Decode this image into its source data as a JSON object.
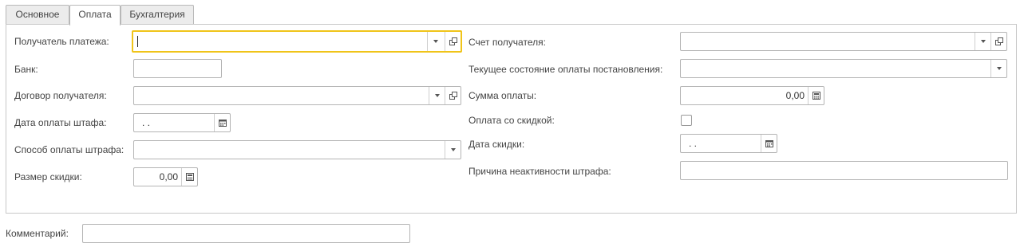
{
  "tabs": [
    {
      "label": "Основное"
    },
    {
      "label": "Оплата"
    },
    {
      "label": "Бухгалтерия"
    }
  ],
  "left": {
    "recipient_label": "Получатель платежа:",
    "bank_label": "Банк:",
    "contract_label": "Договор получателя:",
    "fine_payment_date_label": "Дата оплаты штафа:",
    "fine_payment_date_value": " .  .",
    "fine_payment_method_label": "Способ оплаты штрафа:",
    "discount_size_label": "Размер скидки:",
    "discount_size_value": "0,00"
  },
  "right": {
    "recipient_account_label": "Счет получателя:",
    "current_payment_state_label": "Текущее состояние оплаты постановления:",
    "payment_amount_label": "Сумма оплаты:",
    "payment_amount_value": "0,00",
    "paid_with_discount_label": "Оплата со скидкой:",
    "paid_with_discount_checked": false,
    "discount_date_label": "Дата скидки:",
    "discount_date_value": " .  .",
    "fine_inactivity_reason_label": "Причина неактивности штрафа:"
  },
  "footer": {
    "comment_label": "Комментарий:"
  },
  "icons": {
    "dropdown": "chevron-down-icon",
    "open": "open-form-icon",
    "calculator": "calculator-icon",
    "calendar": "calendar-icon"
  },
  "colors": {
    "focus_border": "#f0c419",
    "field_border": "#b4b4b4",
    "tab_inactive": "#ececec"
  }
}
